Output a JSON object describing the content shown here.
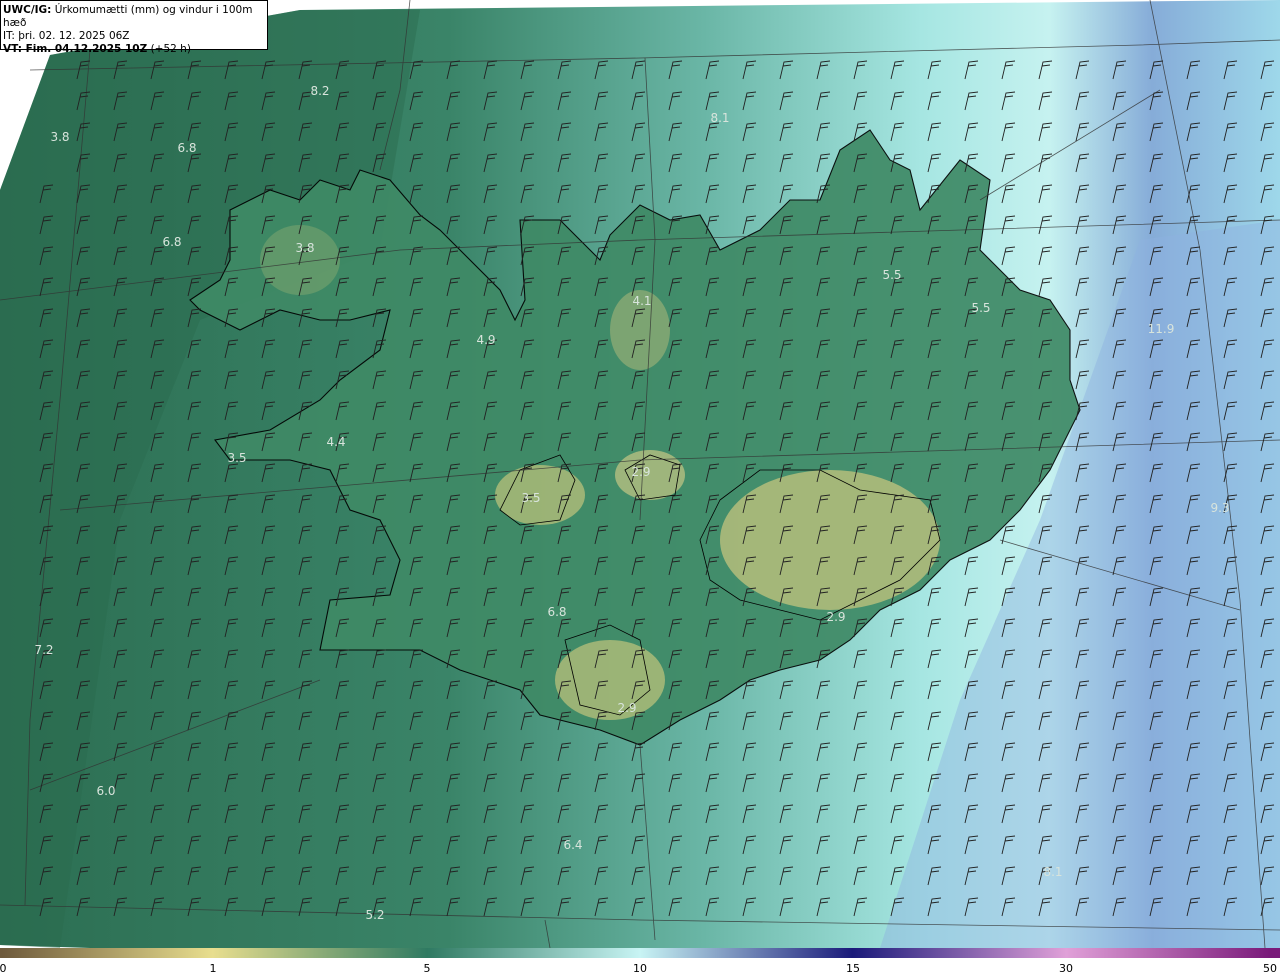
{
  "header": {
    "line1_bold": "UWC/IG:",
    "line1_rest": " Úrkomumætti (mm) og vindur i 100m hæð",
    "line2": "IT: þri. 02. 12. 2025 06Z",
    "line3_bold": "VT: Fim. 04.12.2025 10Z",
    "line3_rest": " (+52 h)"
  },
  "colorbar": {
    "ticks": [
      "0",
      "1",
      "5",
      "10",
      "15",
      "30",
      "50"
    ],
    "stops": [
      {
        "value": "0",
        "color": "#6e5a3c"
      },
      {
        "value": "1",
        "color": "#e8de8e"
      },
      {
        "value": "5",
        "color": "#2f7a62"
      },
      {
        "value": "10",
        "color": "#c8f4f4"
      },
      {
        "value": "15",
        "color": "#1a1a7a"
      },
      {
        "value": "30",
        "color": "#e0a0d8"
      },
      {
        "value": "50",
        "color": "#7a1a7a"
      }
    ]
  },
  "value_labels": [
    "8.2",
    "3.8",
    "6.8",
    "6.8",
    "3.8",
    "4.9",
    "4.1",
    "5.5",
    "5.5",
    "11.9",
    "4.4",
    "3.5",
    "3.5",
    "2.9",
    "6.8",
    "2.9",
    "2.9",
    "7.2",
    "6.0",
    "6.4",
    "5.2",
    "9.3",
    "8.1",
    "8.1"
  ],
  "colors": {
    "land_low": "#c8c87a",
    "sea_dark": "#2f7a62",
    "sea_light": "#bff0ee",
    "sea_blue": "#7fa4d8",
    "coast": "#000000"
  }
}
